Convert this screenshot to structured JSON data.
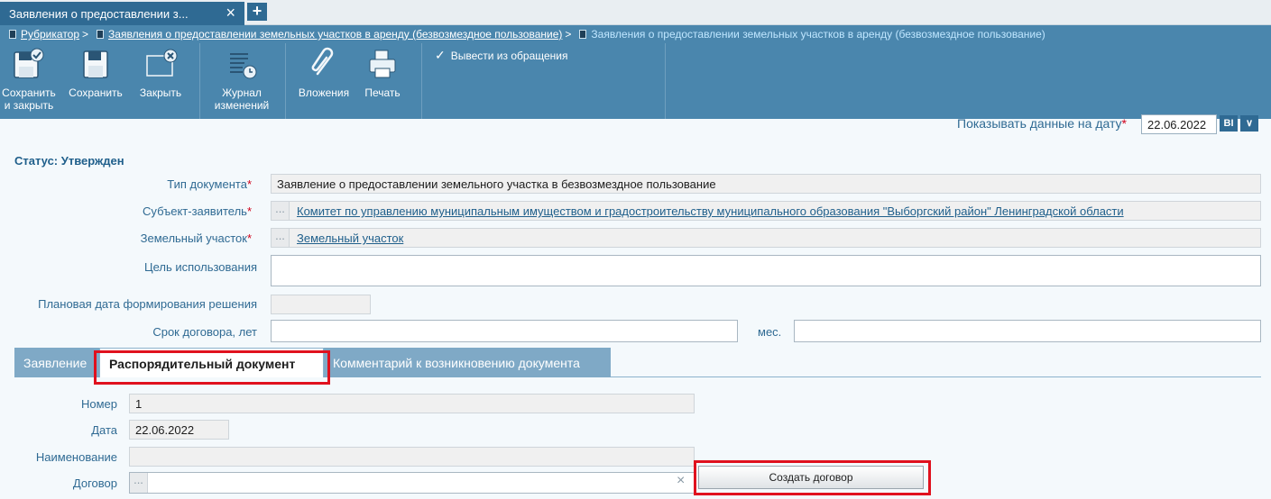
{
  "window": {
    "tab_title": "Заявления о предоставлении з...",
    "close_glyph": "×",
    "add_glyph": "+"
  },
  "breadcrumb": {
    "items": [
      "Рубрикатор",
      "Заявления о предоставлении земельных участков в аренду (безвозмездное пользование)"
    ],
    "current": "Заявления о предоставлении земельных участков в аренду (безвозмездное пользование)",
    "separator": ">"
  },
  "toolbar": {
    "save_close": "Сохранить и закрыть",
    "save": "Сохранить",
    "close": "Закрыть",
    "journal": "Журнал изменений",
    "attachments": "Вложения",
    "print": "Печать",
    "withdraw": "Вывести из обращения"
  },
  "date_filter": {
    "label": "Показывать данные на дату",
    "required": "*",
    "value": "22.06.2022",
    "btn1": "ВI",
    "btn2": "∨"
  },
  "status": "Статус: Утвержден",
  "form": {
    "doc_type": {
      "label": "Тип документа",
      "value": "Заявление о предоставлении земельного участка в безвозмездное пользование"
    },
    "applicant": {
      "label": "Субъект-заявитель",
      "value": "Комитет по управлению муниципальным имуществом и градостроительству муниципального образования \"Выборгский район\" Ленинградской области"
    },
    "land_plot": {
      "label": "Земельный участок",
      "value": "Земельный участок"
    },
    "purpose": {
      "label": "Цель использования",
      "value": ""
    },
    "planned_date": {
      "label": "Плановая дата формирования решения",
      "value": ""
    },
    "contract_term": {
      "label": "Срок договора, лет",
      "value": "",
      "months_label": "мес.",
      "months_value": ""
    },
    "dots": "..."
  },
  "tabs": [
    "Заявление",
    "Распорядительный документ",
    "Комментарий к возникновению документа"
  ],
  "order_doc": {
    "number": {
      "label": "Номер",
      "value": "1"
    },
    "date": {
      "label": "Дата",
      "value": "22.06.2022"
    },
    "name": {
      "label": "Наименование",
      "value": ""
    },
    "contract": {
      "label": "Договор",
      "value": "",
      "clear": "×"
    },
    "create_contract": "Создать договор"
  },
  "colors": {
    "accent": "#4a86ad",
    "highlight": "#e0111e"
  }
}
